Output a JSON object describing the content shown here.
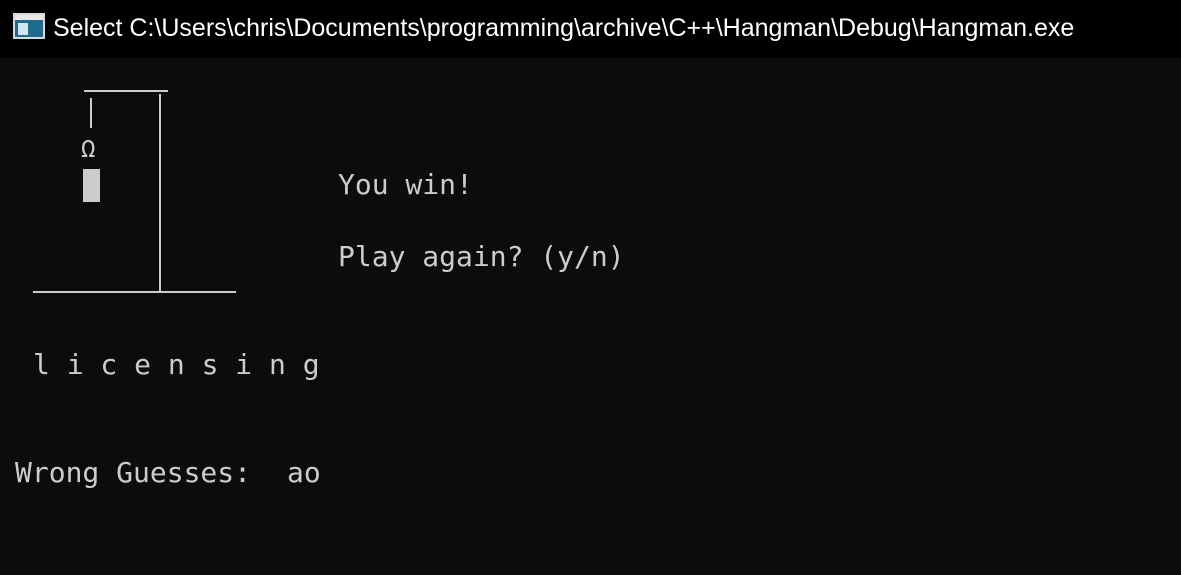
{
  "window": {
    "title": "Select C:\\Users\\chris\\Documents\\programming\\archive\\C++\\Hangman\\Debug\\Hangman.exe",
    "icon": "console-window-icon"
  },
  "console": {
    "hangman": {
      "head_glyph": "Ω",
      "torso": "block"
    },
    "result_message": "You win!",
    "prompt": "Play again? (y/n)",
    "word": "l i c e n s i n g",
    "wrong_guesses_label": "Wrong Guesses:",
    "wrong_guesses_value": "ao"
  },
  "colors": {
    "background": "#0c0c0c",
    "titlebar": "#000000",
    "text": "#cccccc"
  }
}
